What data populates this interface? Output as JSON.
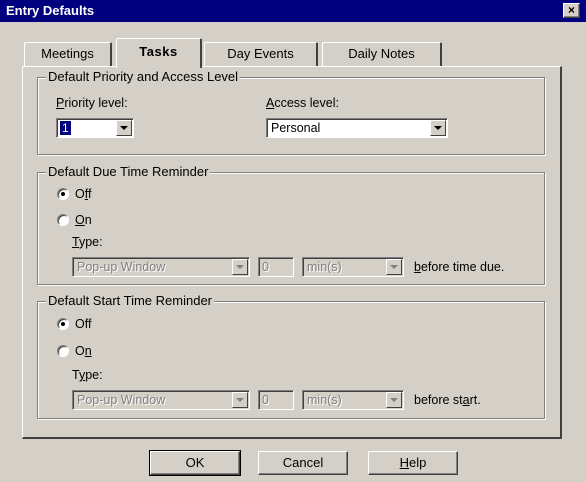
{
  "window": {
    "title": "Entry Defaults",
    "close_glyph": "×"
  },
  "tabs": [
    {
      "label": "Meetings",
      "active": false
    },
    {
      "label": "Tasks",
      "active": true
    },
    {
      "label": "Day Events",
      "active": false
    },
    {
      "label": "Daily Notes",
      "active": false
    }
  ],
  "priority_group": {
    "legend": "Default Priority and Access Level",
    "priority_label_u": "P",
    "priority_label_rest": "riority level:",
    "priority_value": "1",
    "access_label_u": "A",
    "access_label_rest": "ccess level:",
    "access_value": "Personal"
  },
  "due_group": {
    "legend": "Default Due Time Reminder",
    "off_label_pre": "O",
    "off_label_u": "f",
    "off_label_post": "f",
    "on_label_u": "O",
    "on_label_rest": "n",
    "selected": "Off",
    "type_label_u": "T",
    "type_label_rest": "ype:",
    "type_value": "Pop-up Window",
    "amount_value": "0",
    "unit_value": "min(s)",
    "suffix_u": "b",
    "suffix_rest": "efore time due."
  },
  "start_group": {
    "legend": "Default Start Time Reminder",
    "off_label": "Off",
    "on_label_pre": "O",
    "on_label_u": "n",
    "selected": "Off",
    "type_label_pre": "T",
    "type_label_u": "y",
    "type_label_rest": "pe:",
    "type_value": "Pop-up Window",
    "amount_value": "0",
    "unit_value": "min(s)",
    "suffix_pre": "before st",
    "suffix_u": "a",
    "suffix_rest": "rt."
  },
  "buttons": {
    "ok": "OK",
    "cancel": "Cancel",
    "help_u": "H",
    "help_rest": "elp"
  }
}
